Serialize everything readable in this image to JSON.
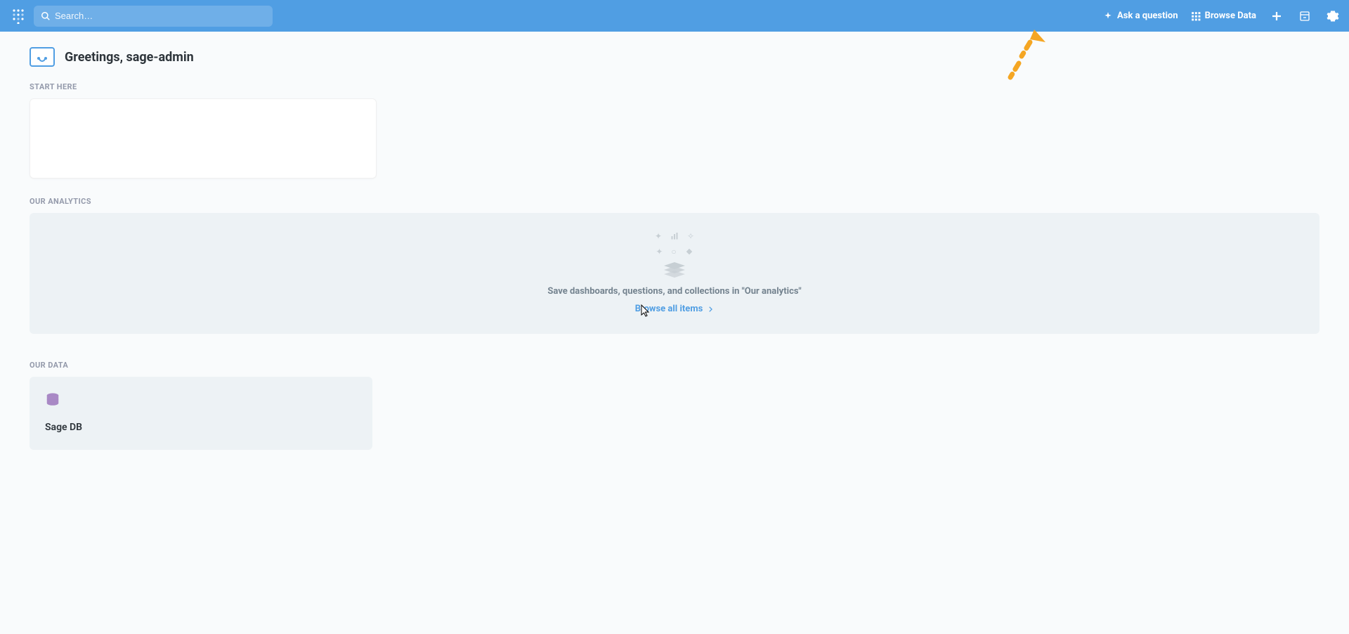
{
  "header": {
    "search_placeholder": "Search…",
    "ask_question": "Ask a question",
    "browse_data": "Browse Data"
  },
  "greeting": "Greetings, sage-admin",
  "sections": {
    "start_here": "START HERE",
    "our_analytics": "OUR ANALYTICS",
    "our_data": "OUR DATA"
  },
  "analytics": {
    "empty_text": "Save dashboards, questions, and collections in \"Our analytics\"",
    "browse_all": "Browse all items"
  },
  "databases": [
    {
      "name": "Sage DB"
    }
  ]
}
